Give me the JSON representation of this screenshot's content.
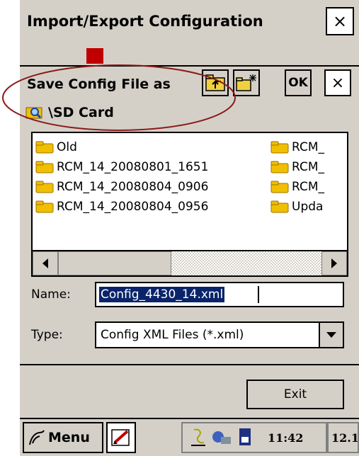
{
  "window": {
    "title": "Import/Export Configuration",
    "close_label": "×"
  },
  "dialog": {
    "title": "Save Config File as",
    "ok_label": "OK",
    "close_label": "×",
    "path": "\\SD Card",
    "files_col1": [
      "Old",
      "RCM_14_20080801_1651",
      "RCM_14_20080804_0906",
      "RCM_14_20080804_0956"
    ],
    "files_col2": [
      "RCM_",
      "RCM_",
      "RCM_",
      "Upda"
    ],
    "name_label": "Name:",
    "name_value": "Config_4430_14.xml",
    "type_label": "Type:",
    "type_value": "Config XML Files (*.xml)"
  },
  "footer": {
    "exit_label": "Exit"
  },
  "taskbar": {
    "menu_label": "Menu",
    "clock": "11:42",
    "tray_text": "12.1"
  },
  "colors": {
    "annotation_ellipse": "#8b1a1a",
    "selection": "#0a246a",
    "folder": "#f0c000"
  }
}
